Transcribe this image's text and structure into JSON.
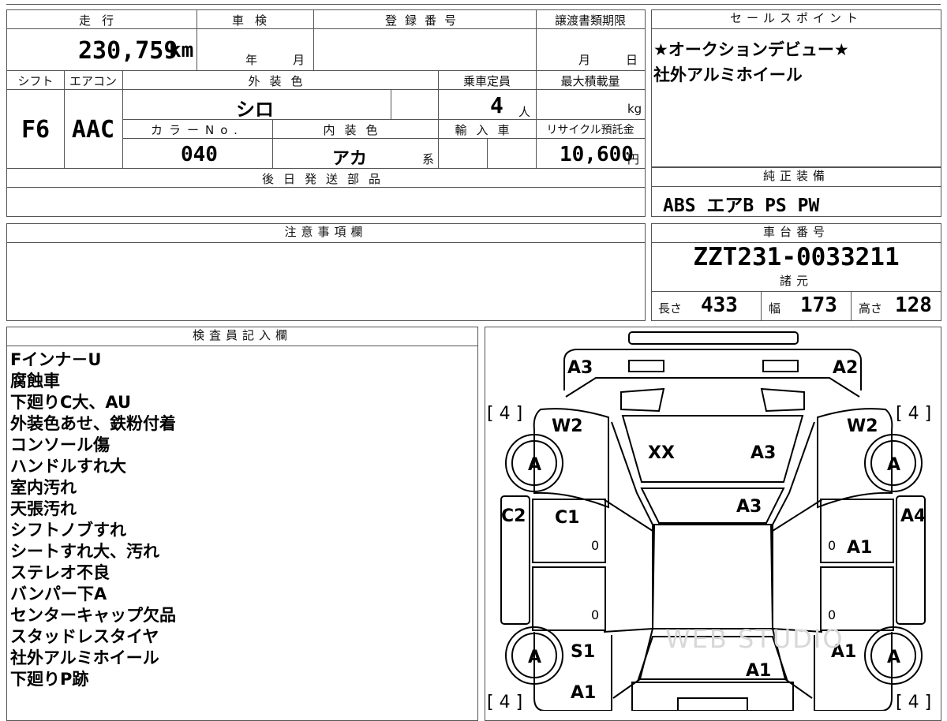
{
  "mileage": {
    "label": "走行",
    "value": "230,759",
    "unit": "km"
  },
  "inspection": {
    "label": "車検",
    "year_unit": "年",
    "month_unit": "月"
  },
  "registration": {
    "label": "登録番号"
  },
  "transfer_deadline": {
    "label": "譲渡書類期限",
    "month_unit": "月",
    "day_unit": "日"
  },
  "sales_point": {
    "label": "セールスポイント",
    "lines": [
      "★オークションデビュー★",
      "社外アルミホイール"
    ]
  },
  "shift": {
    "label": "シフト",
    "value": "F6"
  },
  "aircon": {
    "label": "エアコン",
    "value": "AAC"
  },
  "exterior_color": {
    "label": "外装色",
    "value": "シロ"
  },
  "capacity": {
    "label": "乗車定員",
    "value": "4",
    "unit": "人"
  },
  "max_load": {
    "label": "最大積載量",
    "unit": "kg"
  },
  "color_no": {
    "label": "カラーNo.",
    "value": "040"
  },
  "interior_color": {
    "label": "内装色",
    "value": "アカ",
    "suffix": "系"
  },
  "import": {
    "label": "輸入車"
  },
  "recycle": {
    "label": "リサイクル預託金",
    "value": "10,600",
    "unit": "円"
  },
  "later_parts": {
    "label": "後日発送部品"
  },
  "equipment": {
    "label": "純正装備",
    "value": "ABS エアB PS PW"
  },
  "caution": {
    "label": "注意事項欄"
  },
  "chassis": {
    "label": "車台番号",
    "value": "ZZT231-0033211"
  },
  "specs": {
    "label": "諸元",
    "length_label": "長さ",
    "length": "433",
    "width_label": "幅",
    "width": "173",
    "height_label": "高さ",
    "height": "128"
  },
  "inspector": {
    "label": "検査員記入欄",
    "notes": [
      "Fインナ－U",
      "腐蝕車",
      "下廻りC大、AU",
      "外装色あせ、鉄粉付着",
      "コンソール傷",
      "ハンドルすれ大",
      "室内汚れ",
      "天張汚れ",
      "シフトノブすれ",
      "シートすれ大、汚れ",
      "ステレオ不良",
      "バンパー下A",
      "センターキャップ欠品",
      "スタッドレスタイヤ",
      "社外アルミホイール",
      "下廻りP跡"
    ]
  },
  "diagram": {
    "labels": {
      "front_left": "A3",
      "front_right": "A2",
      "fender_left": "W2",
      "fender_right": "W2",
      "hood_left": "XX",
      "hood_right": "A3",
      "windshield": "A3",
      "side_left": "C2",
      "front_door_left": "C1",
      "side_right": "A4",
      "front_door_right": "A1",
      "rear_left": "S1",
      "rear_right": "A1",
      "roof": "A1",
      "rear_bottom_left": "A1",
      "wheel": "A",
      "tire_bracket": "[ 4 ]",
      "zero": "0"
    },
    "watermark": "WEB STUDIO"
  }
}
